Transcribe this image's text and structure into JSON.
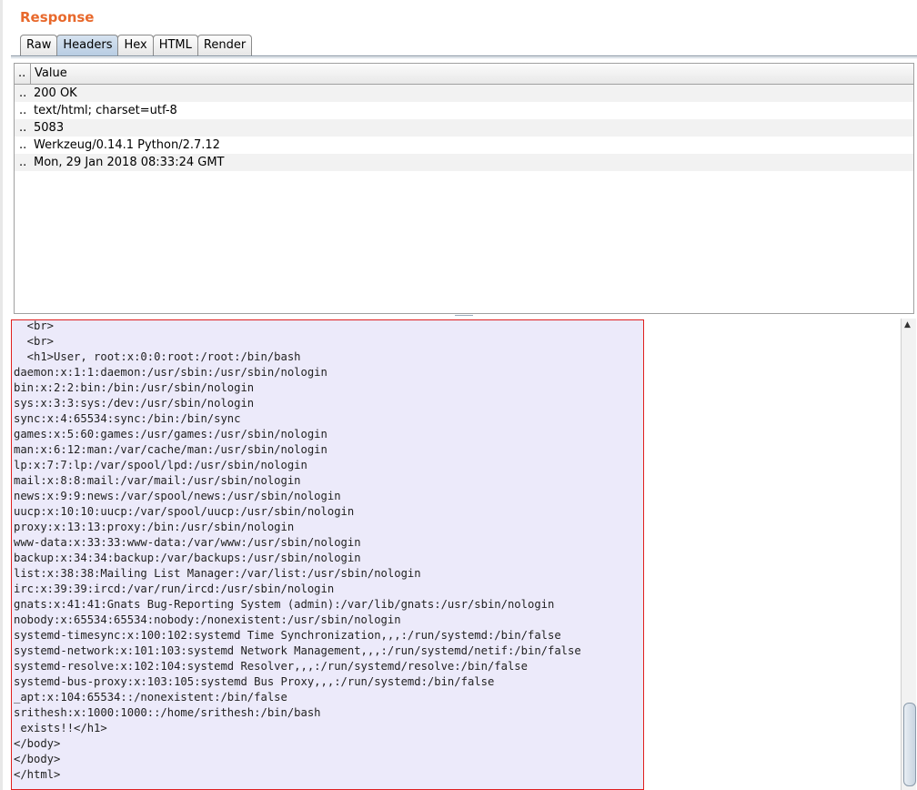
{
  "panel": {
    "title": "Response"
  },
  "tabs": [
    {
      "label": "Raw"
    },
    {
      "label": "Headers"
    },
    {
      "label": "Hex"
    },
    {
      "label": "HTML"
    },
    {
      "label": "Render"
    }
  ],
  "active_tab": "Headers",
  "headers_table": {
    "columns": [
      ".. ",
      "Value"
    ],
    "rows": [
      {
        "name": "..",
        "value": "200 OK"
      },
      {
        "name": "..",
        "value": "text/html; charset=utf-8"
      },
      {
        "name": "..",
        "value": "5083"
      },
      {
        "name": "..",
        "value": "Werkzeug/0.14.1 Python/2.7.12"
      },
      {
        "name": "..",
        "value": "Mon, 29 Jan 2018 08:33:24 GMT"
      }
    ]
  },
  "body_lines": [
    "  <br>",
    "  <br>",
    "  <h1>User, root:x:0:0:root:/root:/bin/bash",
    "daemon:x:1:1:daemon:/usr/sbin:/usr/sbin/nologin",
    "bin:x:2:2:bin:/bin:/usr/sbin/nologin",
    "sys:x:3:3:sys:/dev:/usr/sbin/nologin",
    "sync:x:4:65534:sync:/bin:/bin/sync",
    "games:x:5:60:games:/usr/games:/usr/sbin/nologin",
    "man:x:6:12:man:/var/cache/man:/usr/sbin/nologin",
    "lp:x:7:7:lp:/var/spool/lpd:/usr/sbin/nologin",
    "mail:x:8:8:mail:/var/mail:/usr/sbin/nologin",
    "news:x:9:9:news:/var/spool/news:/usr/sbin/nologin",
    "uucp:x:10:10:uucp:/var/spool/uucp:/usr/sbin/nologin",
    "proxy:x:13:13:proxy:/bin:/usr/sbin/nologin",
    "www-data:x:33:33:www-data:/var/www:/usr/sbin/nologin",
    "backup:x:34:34:backup:/var/backups:/usr/sbin/nologin",
    "list:x:38:38:Mailing List Manager:/var/list:/usr/sbin/nologin",
    "irc:x:39:39:ircd:/var/run/ircd:/usr/sbin/nologin",
    "gnats:x:41:41:Gnats Bug-Reporting System (admin):/var/lib/gnats:/usr/sbin/nologin",
    "nobody:x:65534:65534:nobody:/nonexistent:/usr/sbin/nologin",
    "systemd-timesync:x:100:102:systemd Time Synchronization,,,:/run/systemd:/bin/false",
    "systemd-network:x:101:103:systemd Network Management,,,:/run/systemd/netif:/bin/false",
    "systemd-resolve:x:102:104:systemd Resolver,,,:/run/systemd/resolve:/bin/false",
    "systemd-bus-proxy:x:103:105:systemd Bus Proxy,,,:/run/systemd:/bin/false",
    "_apt:x:104:65534::/nonexistent:/bin/false",
    "srithesh:x:1000:1000::/home/srithesh:/bin/bash",
    " exists!!</h1>",
    "</body>",
    "</body>",
    "</html>"
  ],
  "colors": {
    "title": "#e8692c",
    "selection_border": "#e01f1f",
    "selection_bg": "#eceafa"
  },
  "icons": {
    "scroll_up": "scroll-up-arrow-icon"
  }
}
